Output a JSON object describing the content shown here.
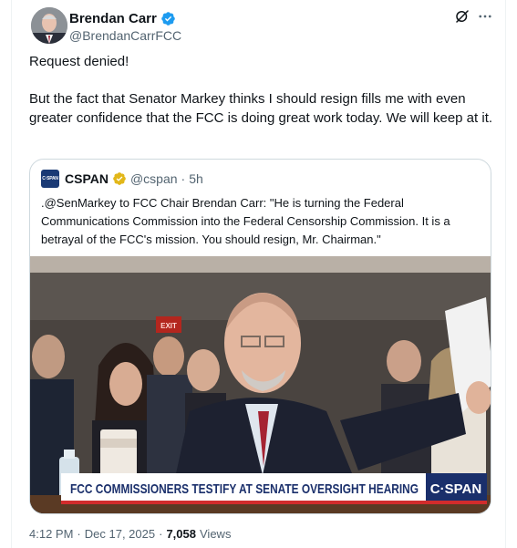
{
  "author": {
    "name": "Brendan Carr",
    "handle": "@BrendanCarrFCC"
  },
  "tweet": {
    "line1": "Request denied!",
    "line2": "But the fact that Senator Markey thinks I should resign fills me with even greater confidence that the FCC is doing great work today.  We will keep at it."
  },
  "quote": {
    "avatar_text": "C·SPAN",
    "name": "CSPAN",
    "handle": "@cspan",
    "separator": "·",
    "time": "5h",
    "text": ".@SenMarkey to FCC Chair Brendan Carr: \"He is turning the Federal Communications Commission into the Federal Censorship Commission. It is a betrayal of the FCC's mission. You should resign, Mr. Chairman.\"",
    "media": {
      "chyron": "FCC COMMISSIONERS TESTIFY AT SENATE OVERSIGHT HEARING",
      "bug": "C·SPAN",
      "exit_sign": "EXIT"
    }
  },
  "meta": {
    "time": "4:12 PM",
    "sep1": "·",
    "date": "Dec 17, 2025",
    "sep2": "·",
    "views_count": "7,058",
    "views_label": "Views"
  },
  "colors": {
    "verified_blue": "#1d9bf0",
    "verified_gold": "#e2b719",
    "chyron_bg": "#ffffff",
    "chyron_text": "#1a2f6b",
    "bug_bg": "#1a2f6b"
  },
  "icons": {
    "verified": "verified-badge-icon",
    "gold_verified": "gold-verified-badge-icon",
    "grok": "grok-icon",
    "more": "more-dots-icon"
  }
}
